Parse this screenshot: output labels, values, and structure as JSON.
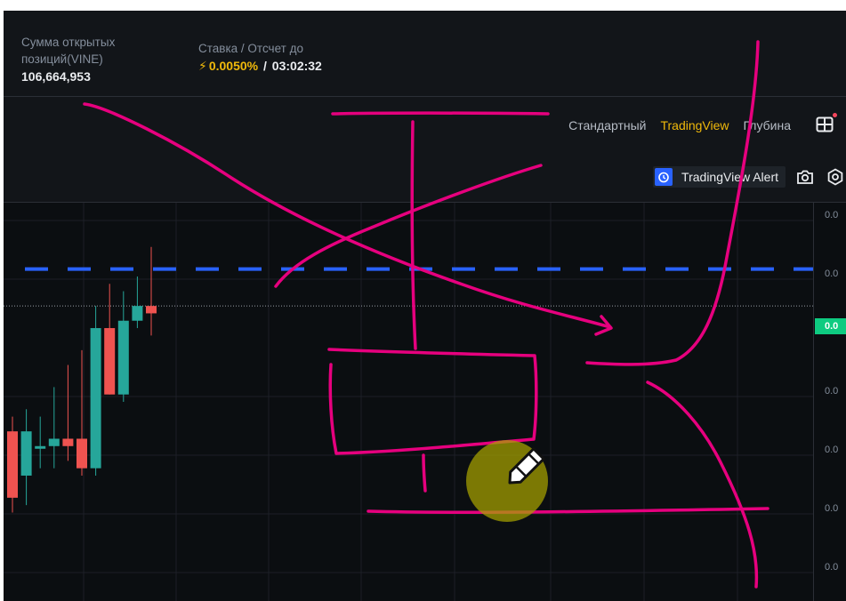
{
  "stats": {
    "open_interest": {
      "label": "Сумма открытых позиций(VINE)",
      "value": "106,664,953"
    },
    "funding": {
      "label": "Ставка / Отсчет до",
      "rate": "0.0050%",
      "separator": " / ",
      "countdown": "03:02:32"
    }
  },
  "chart_tabs": [
    {
      "label": "Стандартный",
      "active": false
    },
    {
      "label": "TradingView",
      "active": true
    },
    {
      "label": "Глубина",
      "active": false
    }
  ],
  "tools": {
    "alert_label": "TradingView Alert",
    "icons": [
      "grid-layout-icon",
      "camera-icon",
      "settings-icon",
      "alarm-clock-icon"
    ]
  },
  "price_axis": {
    "labels": [
      "0.0",
      "0.0",
      "0.0",
      "0.0",
      "0.0",
      "0.0",
      "0.0"
    ],
    "current_price_tag": "0.0"
  },
  "colors": {
    "up": "#26a69a",
    "down": "#ef5350",
    "accent": "#f0b90b",
    "price_tag": "#0ecb81",
    "dashed_line": "#2962ff",
    "annotation": "#e6007e"
  },
  "chart_data": {
    "type": "candlestick",
    "candles": [
      {
        "open": 0.35,
        "close": 0.26,
        "high": 0.37,
        "low": 0.24
      },
      {
        "open": 0.29,
        "close": 0.35,
        "high": 0.38,
        "low": 0.25
      },
      {
        "open": 0.33,
        "close": 0.33,
        "high": 0.37,
        "low": 0.3
      },
      {
        "open": 0.33,
        "close": 0.34,
        "high": 0.41,
        "low": 0.3
      },
      {
        "open": 0.34,
        "close": 0.33,
        "high": 0.44,
        "low": 0.31
      },
      {
        "open": 0.34,
        "close": 0.3,
        "high": 0.46,
        "low": 0.29
      },
      {
        "open": 0.3,
        "close": 0.49,
        "high": 0.52,
        "low": 0.29
      },
      {
        "open": 0.49,
        "close": 0.4,
        "high": 0.55,
        "low": 0.4
      },
      {
        "open": 0.4,
        "close": 0.5,
        "high": 0.54,
        "low": 0.39
      },
      {
        "open": 0.5,
        "close": 0.52,
        "high": 0.56,
        "low": 0.49
      },
      {
        "open": 0.52,
        "close": 0.51,
        "high": 0.6,
        "low": 0.48
      }
    ],
    "dashed_level": 0.57,
    "current_price_level": 0.52,
    "ylim": [
      0.12,
      0.66
    ]
  }
}
